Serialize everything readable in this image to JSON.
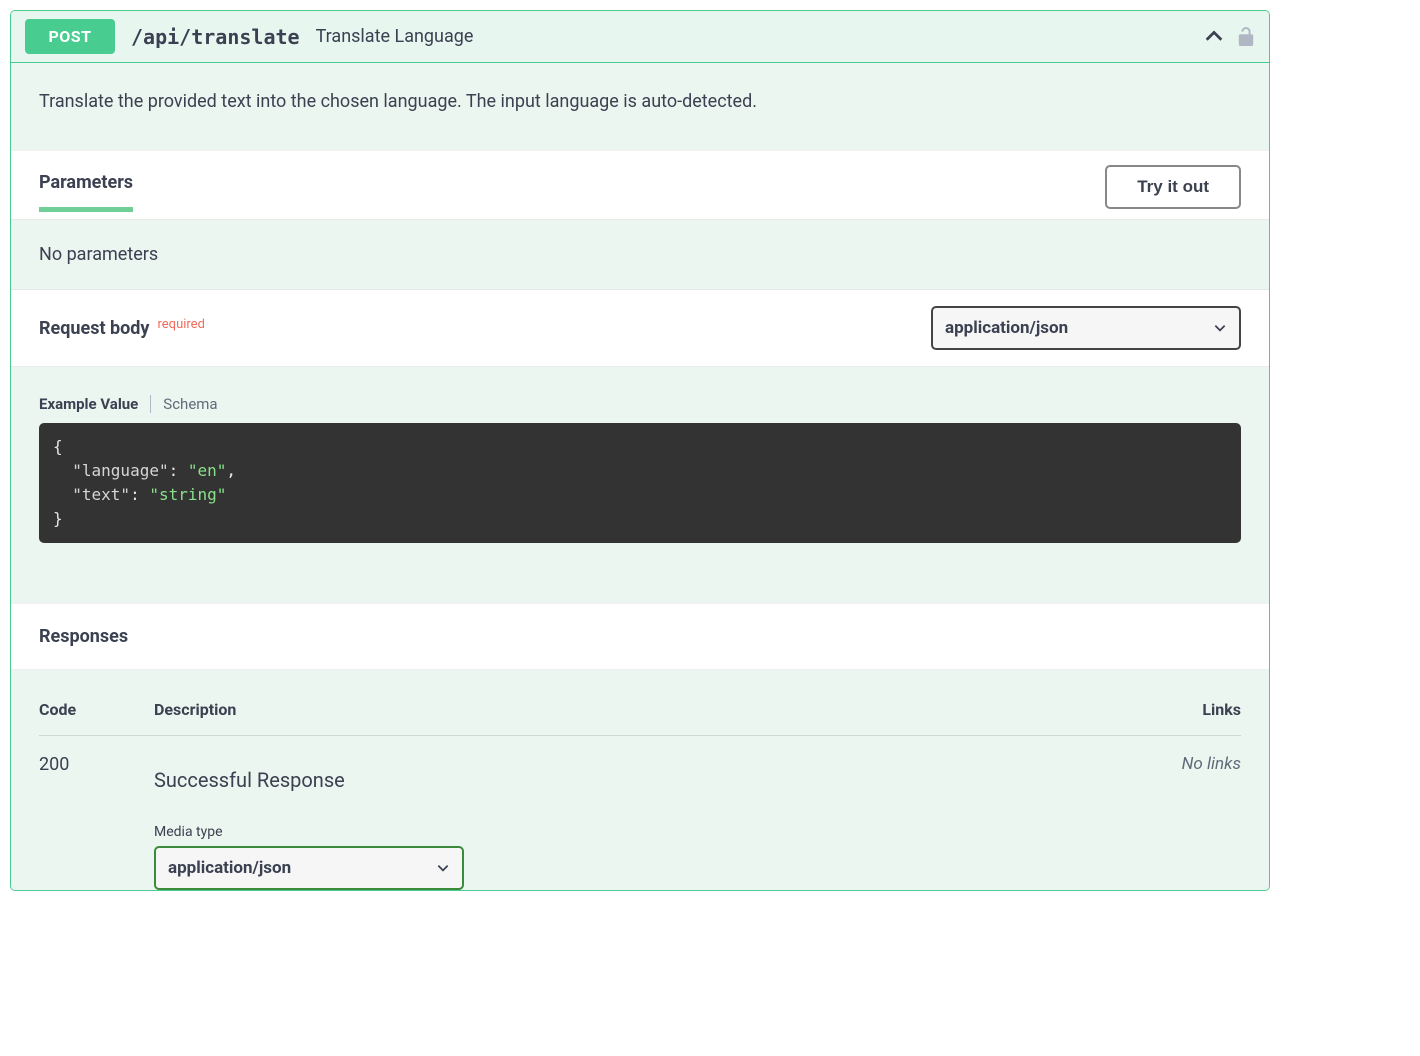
{
  "header": {
    "method": "POST",
    "path": "/api/translate",
    "summary": "Translate Language"
  },
  "description": "Translate the provided text into the chosen language. The input language is auto-detected.",
  "parameters": {
    "tab_label": "Parameters",
    "try_label": "Try it out",
    "empty": "No parameters"
  },
  "request_body": {
    "label": "Request body",
    "required_tag": "required",
    "content_type": "application/json",
    "model_tabs": {
      "example": "Example Value",
      "schema": "Schema"
    },
    "example": {
      "language": "en",
      "text": "string"
    }
  },
  "responses": {
    "label": "Responses",
    "columns": {
      "code": "Code",
      "description": "Description",
      "links": "Links"
    },
    "rows": [
      {
        "code": "200",
        "description": "Successful Response",
        "links": "No links",
        "media_label": "Media type",
        "media_type": "application/json"
      }
    ]
  }
}
